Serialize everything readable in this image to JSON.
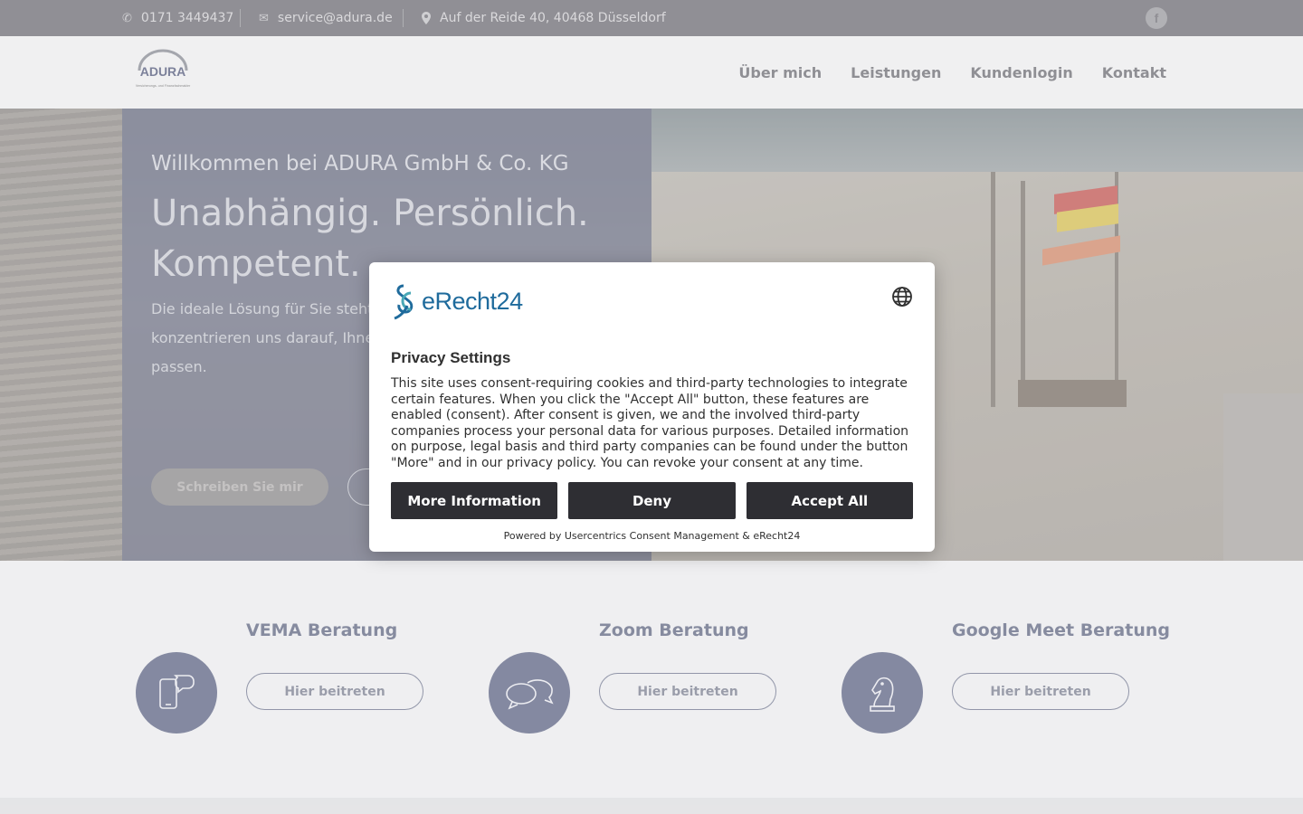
{
  "topbar": {
    "phone": "0171 3449437",
    "email": "service@adura.de",
    "address": "Auf der Reide 40, 40468 Düsseldorf",
    "facebook": "f"
  },
  "logo": {
    "name": "ADURA",
    "tagline": "Versicherungs- und Finanzfachmakler"
  },
  "nav": {
    "items": [
      "Über mich",
      "Leistungen",
      "Kundenlogin",
      "Kontakt"
    ]
  },
  "hero": {
    "welcome": "Willkommen bei ADURA GmbH & Co. KG",
    "headline": "Unabhängig. Persönlich. Kompetent.",
    "text": "Die ideale Lösung für Sie steht im Investmentfonds, Altersvorsorge konzentrieren uns darauf, Ihnen anzubieten, die zu Ihren individu passen.",
    "primary_button": "Schreiben Sie mir"
  },
  "cards": [
    {
      "title": "VEMA Beratung",
      "button": "Hier beitreten",
      "icon": "phone-chat-icon"
    },
    {
      "title": "Zoom Beratung",
      "button": "Hier beitreten",
      "icon": "chat-bubbles-icon"
    },
    {
      "title": "Google Meet Beratung",
      "button": "Hier beitreten",
      "icon": "chess-knight-icon"
    }
  ],
  "consent": {
    "brand": "eRecht24",
    "title": "Privacy Settings",
    "description": "This site uses consent-requiring cookies and third-party technologies to integrate certain features. When you click the \"Accept All\" button, these features are enabled (consent). After consent is given, we and the involved third-party companies process your personal data for various purposes. Detailed information on purpose, legal basis and third party companies can be found under the button \"More\" and in our privacy policy. You can revoke your consent at any time.",
    "more_button": "More Information",
    "deny_button": "Deny",
    "accept_button": "Accept All",
    "powered": "Powered by Usercentrics Consent Management & eRecht24"
  },
  "colors": {
    "topbar": "#5c5b63",
    "accent": "#4b5275",
    "button_dark": "#2e2e33",
    "brand_blue": "#1f6b9c"
  }
}
